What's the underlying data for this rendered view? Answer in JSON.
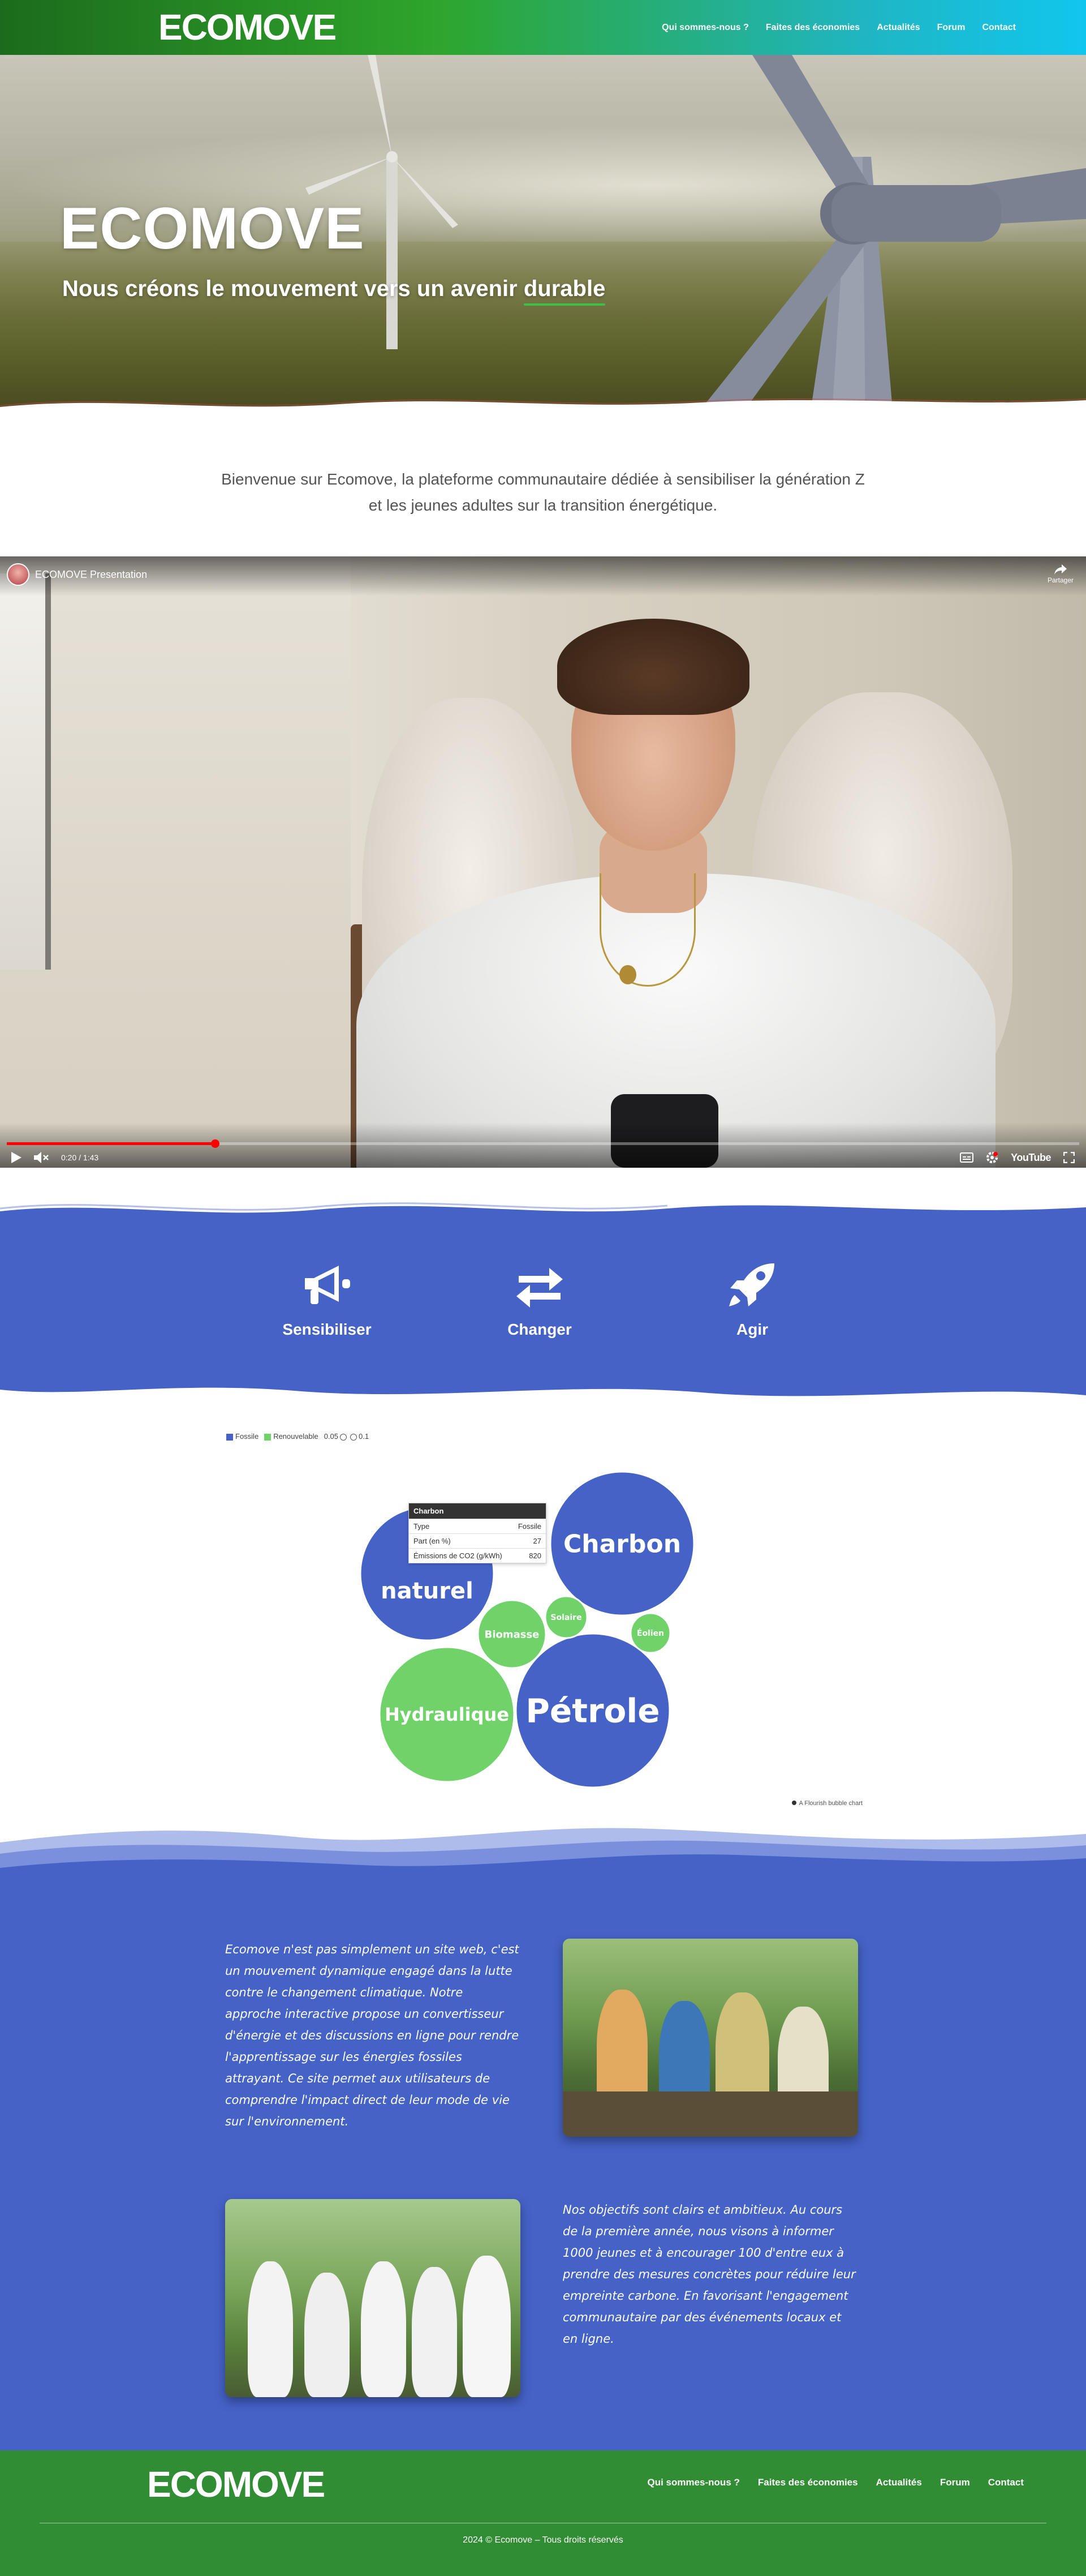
{
  "header": {
    "logo": {
      "eco": "ECO",
      "move": "MOVE"
    },
    "nav": [
      {
        "label": "Qui sommes-nous ?"
      },
      {
        "label": "Faites des économies"
      },
      {
        "label": "Actualités"
      },
      {
        "label": "Forum"
      },
      {
        "label": "Contact"
      }
    ]
  },
  "hero": {
    "title": "ECOMOVE",
    "subtitle_before": "Nous créons le mouvement vers un avenir ",
    "subtitle_highlight": "durable"
  },
  "intro": {
    "text": "Bienvenue sur Ecomove, la plateforme communautaire dédiée à sensibiliser la génération Z et les jeunes adultes sur la transition énergétique."
  },
  "video": {
    "title": "ECOMOVE Presentation",
    "share_label": "Partager",
    "time": "0:20 / 1:43",
    "progress": 0.194,
    "platform": "YouTube"
  },
  "features": [
    {
      "label": "Sensibiliser",
      "icon": "megaphone-icon"
    },
    {
      "label": "Changer",
      "icon": "exchange-arrows-icon"
    },
    {
      "label": "Agir",
      "icon": "rocket-icon"
    }
  ],
  "chart_data": {
    "type": "bubble",
    "legend": [
      {
        "name": "Fossile",
        "color": "#4562c7"
      },
      {
        "name": "Renouvelable",
        "color": "#6fd36a"
      }
    ],
    "size_legend": [
      "0.05",
      "0.1"
    ],
    "bubbles": [
      {
        "name": "Gaz naturel",
        "label": "naturel",
        "type": "Fossile"
      },
      {
        "name": "Charbon",
        "type": "Fossile",
        "share": 27,
        "co2": 820
      },
      {
        "name": "Pétrole",
        "type": "Fossile"
      },
      {
        "name": "Hydraulique",
        "type": "Renouvelable"
      },
      {
        "name": "Biomasse",
        "type": "Renouvelable"
      },
      {
        "name": "Solaire",
        "type": "Renouvelable"
      },
      {
        "name": "Éolien",
        "type": "Renouvelable"
      }
    ],
    "tooltip": {
      "title": "Charbon",
      "rows": [
        {
          "key": "Type",
          "value": "Fossile"
        },
        {
          "key": "Part (en %)",
          "value": "27"
        },
        {
          "key": "Émissions de CO2 (g/kWh)",
          "value": "820"
        }
      ]
    },
    "credit": "A Flourish bubble chart"
  },
  "about": {
    "paragraph1": "Ecomove n'est pas simplement un site web, c'est un mouvement dynamique engagé dans la lutte contre le changement climatique. Notre approche interactive propose un convertisseur d'énergie et des discussions en ligne pour rendre l'apprentissage sur les énergies fossiles attrayant. Ce site permet aux utilisateurs de comprendre l'impact direct de leur mode de vie sur l'environnement.",
    "paragraph2": "Nos objectifs sont clairs et ambitieux. Au cours de la première année, nous visons à informer 1000 jeunes et à encourager 100 d'entre eux à prendre des mesures concrètes pour réduire leur empreinte carbone. En favorisant l'engagement communautaire par des événements locaux et en ligne."
  },
  "footer": {
    "logo": {
      "eco": "ECO",
      "move": "MOVE"
    },
    "nav": [
      {
        "label": "Qui sommes-nous ?"
      },
      {
        "label": "Faites des économies"
      },
      {
        "label": "Actualités"
      },
      {
        "label": "Forum"
      },
      {
        "label": "Contact"
      }
    ],
    "copyright": "2024 © Ecomove – Tous droits réservés"
  },
  "colors": {
    "brand_green": "#318d34",
    "band_blue": "#4562c7",
    "renewable_green": "#6fd36a",
    "fossil_blue": "#4562c7"
  }
}
